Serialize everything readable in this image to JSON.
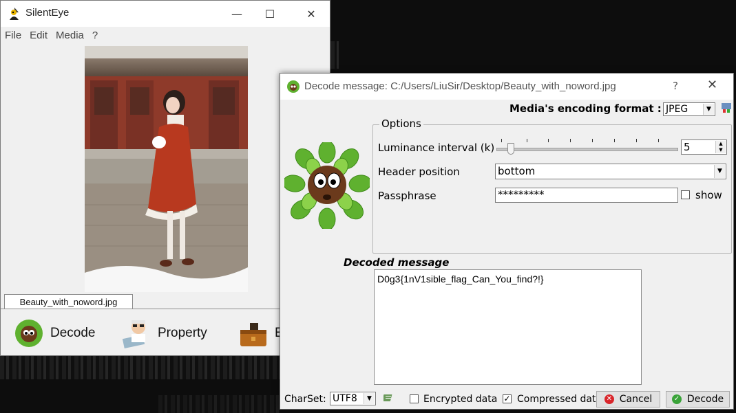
{
  "main_window": {
    "title": "SilentEye",
    "menu": [
      "File",
      "Edit",
      "Media",
      "?"
    ],
    "file_tab": "Beauty_with_noword.jpg",
    "toolbar": {
      "decode_label": "Decode",
      "property_label": "Property",
      "encode_label": "E"
    }
  },
  "dialog": {
    "title": "Decode message: C:/Users/LiuSir/Desktop/Beauty_with_noword.jpg",
    "help": "?",
    "format_label": "Media's encoding format :",
    "format_value": "JPEG",
    "options_title": "Options",
    "luminance_label": "Luminance interval (k)",
    "luminance_value": "5",
    "slider_level_fraction": 0.05,
    "header_label": "Header position",
    "header_value": "bottom",
    "passphrase_label": "Passphrase",
    "passphrase_value": "*********",
    "show_label": "show",
    "decoded_label": "Decoded message",
    "decoded_text": "D0g3{1nV1sible_flag_Can_You_find?!}",
    "charset_label": "CharSet:",
    "charset_value": "UTF8",
    "encrypted_label": "Encrypted data",
    "encrypted_checked": false,
    "compressed_label": "Compressed dat",
    "compressed_checked": true,
    "cancel_label": "Cancel",
    "decode_label": "Decode"
  },
  "colors": {
    "cancel_icon": "#d9262b",
    "decode_icon": "#3aa339",
    "leaf_green": "#5fb12f"
  },
  "icons": [
    "app-icon",
    "close-icon",
    "maximize-icon",
    "minimize-icon",
    "mascot-icon",
    "property-icon",
    "encode-icon",
    "plugin-icon",
    "cancel-icon",
    "decode-icon"
  ]
}
